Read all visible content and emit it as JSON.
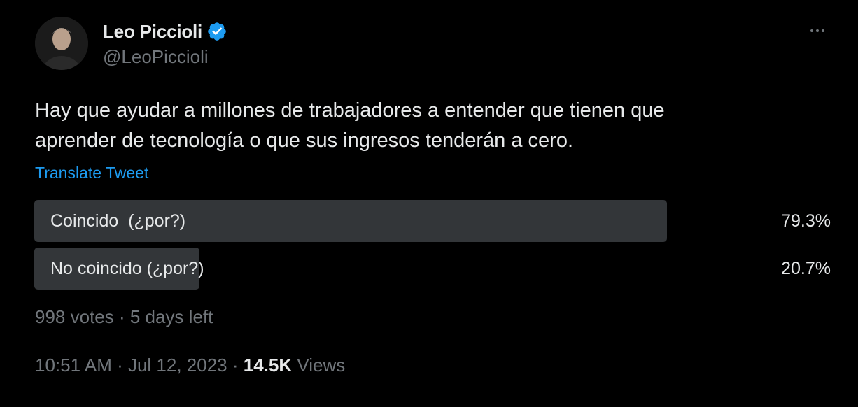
{
  "author": {
    "display_name": "Leo Piccioli",
    "handle": "@LeoPiccioli",
    "verified": true,
    "verified_color": "#1d9bf0"
  },
  "tweet": {
    "text": "Hay que ayudar a millones de trabajadores a entender que tienen que\naprender de tecnología o que sus ingresos tenderán a cero.",
    "translate_label": "Translate Tweet"
  },
  "poll": {
    "options": [
      {
        "label": "Coincido  (¿por?)",
        "percent_label": "79.3%",
        "percent": 79.3
      },
      {
        "label": "No coincido (¿por?)",
        "percent_label": "20.7%",
        "percent": 20.7
      }
    ],
    "votes": "998 votes",
    "separator": " · ",
    "time_left": "5 days left"
  },
  "meta": {
    "time": "10:51 AM",
    "separator": " · ",
    "date": "Jul 12, 2023",
    "views_count": "14.5K",
    "views_label": "Views"
  },
  "icons": {
    "verified": "verified-badge-icon",
    "more": "more-horizontal-icon"
  },
  "colors": {
    "background": "#000000",
    "text": "#e7e9ea",
    "secondary": "#71767b",
    "link": "#1d9bf0",
    "poll_bar": "#333639"
  }
}
